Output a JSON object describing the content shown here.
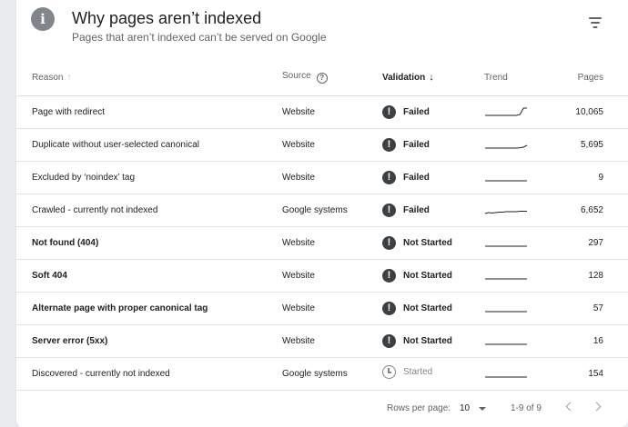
{
  "header": {
    "title": "Why pages aren’t indexed",
    "subtitle": "Pages that aren’t indexed can’t be served on Google",
    "info_glyph": "i"
  },
  "columns": {
    "reason": "Reason",
    "source": "Source",
    "validation": "Validation",
    "trend": "Trend",
    "pages": "Pages"
  },
  "sort": {
    "inactive_arrow": "↑",
    "active_arrow": "↓"
  },
  "help_glyph": "?",
  "status_glyphs": {
    "failed": "!",
    "not_started": "!",
    "started": ""
  },
  "rows": [
    {
      "reason": "Page with redirect",
      "bold": false,
      "source": "Website",
      "validation": "Failed",
      "status": "failed",
      "pages": "10,065",
      "trend": [
        1,
        1,
        1,
        1,
        1,
        1,
        1,
        1,
        1,
        1,
        2,
        9,
        9
      ]
    },
    {
      "reason": "Duplicate without user-selected canonical",
      "bold": false,
      "source": "Website",
      "validation": "Failed",
      "status": "failed",
      "pages": "5,695",
      "trend": [
        1,
        1,
        1,
        1,
        1,
        1,
        1,
        1,
        1,
        1,
        1.4,
        2,
        4
      ]
    },
    {
      "reason": "Excluded by ‘noindex’ tag",
      "bold": false,
      "source": "Website",
      "validation": "Failed",
      "status": "failed",
      "pages": "9",
      "trend": [
        1,
        1,
        1,
        1,
        1,
        1,
        1,
        1,
        1,
        1,
        1,
        1,
        1
      ]
    },
    {
      "reason": "Crawled - currently not indexed",
      "bold": false,
      "source": "Google systems",
      "validation": "Failed",
      "status": "failed",
      "pages": "6,652",
      "trend": [
        1,
        2,
        1.5,
        2,
        2.5,
        2.5,
        3,
        3,
        3,
        3,
        3.5,
        3.5,
        3.5
      ]
    },
    {
      "reason": "Not found (404)",
      "bold": true,
      "source": "Website",
      "validation": "Not Started",
      "status": "not-started",
      "pages": "297",
      "trend": [
        1,
        1,
        1,
        1,
        1,
        1,
        1,
        1,
        1,
        1,
        1,
        1,
        1
      ]
    },
    {
      "reason": "Soft 404",
      "bold": true,
      "source": "Website",
      "validation": "Not Started",
      "status": "not-started",
      "pages": "128",
      "trend": [
        1,
        1,
        1,
        1,
        1,
        1,
        1,
        1,
        1,
        1,
        1,
        1,
        1
      ]
    },
    {
      "reason": "Alternate page with proper canonical tag",
      "bold": true,
      "source": "Website",
      "validation": "Not Started",
      "status": "not-started",
      "pages": "57",
      "trend": [
        1,
        1,
        1,
        1,
        1,
        1,
        1,
        1,
        1,
        1,
        1,
        1,
        1
      ]
    },
    {
      "reason": "Server error (5xx)",
      "bold": true,
      "source": "Website",
      "validation": "Not Started",
      "status": "not-started",
      "pages": "16",
      "trend": [
        1,
        1,
        1,
        1,
        1,
        1,
        1,
        1,
        1,
        1,
        1,
        1,
        1
      ]
    },
    {
      "reason": "Discovered - currently not indexed",
      "bold": false,
      "source": "Google systems",
      "validation": "Started",
      "status": "started",
      "pages": "154",
      "trend": [
        1,
        1,
        1,
        1,
        1,
        1,
        1,
        1,
        1,
        1,
        1,
        1,
        1
      ]
    }
  ],
  "footer": {
    "rows_per_page_label": "Rows per page:",
    "rows_per_page_value": "10",
    "range": "1-9 of 9"
  },
  "icons": {
    "info": "info-icon",
    "filter": "filter-icon",
    "help": "help-circle-icon",
    "failed": "exclamation-icon",
    "not_started": "exclamation-icon",
    "started": "clock-icon",
    "prev": "chevron-left-icon",
    "next": "chevron-right-icon"
  },
  "colors": {
    "status_icon": "#3c4043",
    "started_text": "#80868b",
    "trend_line": "#202124",
    "page_bg": "#e9ebef"
  }
}
